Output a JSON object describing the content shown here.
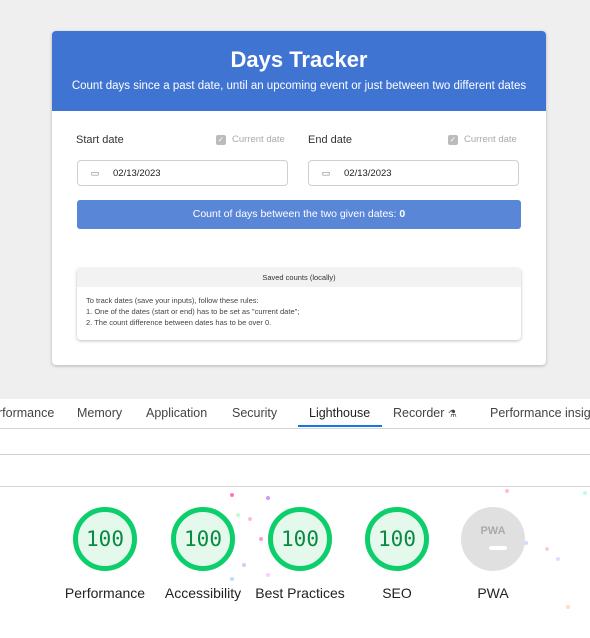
{
  "tracker": {
    "title": "Days Tracker",
    "subtitle": "Count days since a past date, until an upcoming event or just between two different dates",
    "start_label": "Start date",
    "end_label": "End date",
    "current_date_label": "Current date",
    "start_value": "02/13/2023",
    "end_value": "02/13/2023",
    "count_text": "Count of days between the two given dates: ",
    "count_value": "0",
    "saved_title": "Saved counts (locally)",
    "saved_rules": [
      "To track dates (save your inputs), follow these rules:",
      "1. One of the dates (start or end) has to be set as \"current date\";",
      "2. The count difference between dates has to be over 0."
    ]
  },
  "devtools": {
    "tabs": [
      "rformance",
      "Memory",
      "Application",
      "Security",
      "Lighthouse",
      "Recorder",
      "Performance insig"
    ],
    "active_tab": "Lighthouse"
  },
  "scores": [
    {
      "label": "Performance",
      "value": "100"
    },
    {
      "label": "Accessibility",
      "value": "100"
    },
    {
      "label": "Best Practices",
      "value": "100"
    },
    {
      "label": "SEO",
      "value": "100"
    },
    {
      "label": "PWA",
      "value": "PWA"
    }
  ],
  "colors": {
    "header": "#3f74d2",
    "button": "#5a86d8",
    "pass": "#0cce6b",
    "tab_underline": "#1a73e8"
  },
  "icons": {
    "calendar": "calendar-icon",
    "checkbox": "check-icon",
    "recorder": "flask-icon"
  }
}
